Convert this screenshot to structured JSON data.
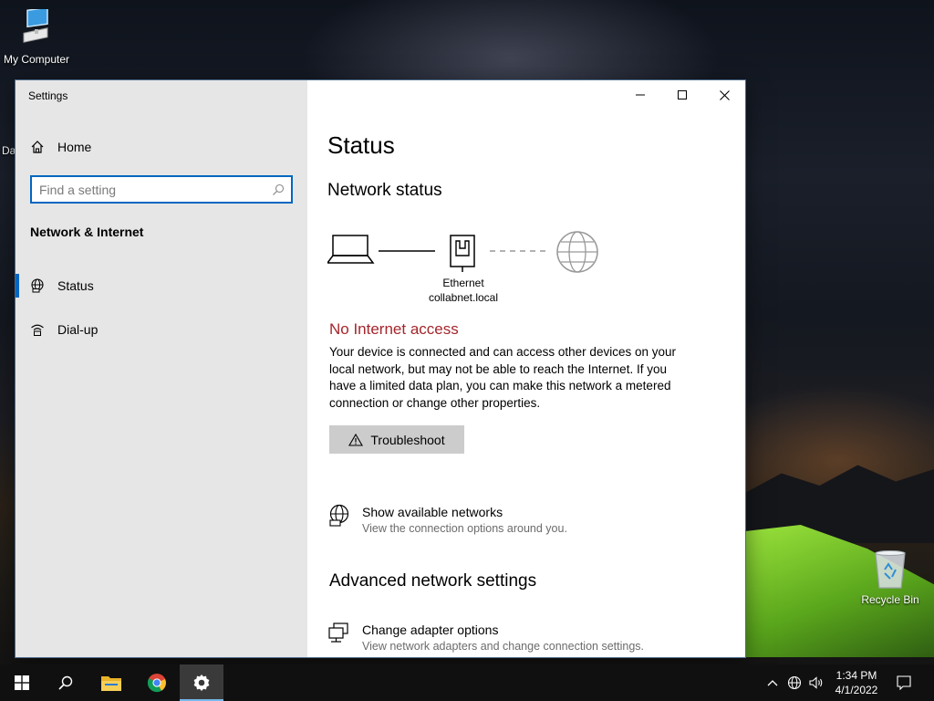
{
  "desktop": {
    "my_computer_label": "My Computer",
    "truncated_label": "Da",
    "recycle_bin_label": "Recycle Bin"
  },
  "window": {
    "title": "Settings",
    "controls": {
      "minimize": "minimize-icon",
      "maximize": "maximize-icon",
      "close": "close-icon"
    }
  },
  "sidebar": {
    "home_label": "Home",
    "search_placeholder": "Find a setting",
    "section_title": "Network & Internet",
    "items": [
      {
        "label": "Status",
        "icon": "globe-icon",
        "active": true
      },
      {
        "label": "Dial-up",
        "icon": "dial-up-icon",
        "active": false
      }
    ]
  },
  "content": {
    "title": "Status",
    "network_status_title": "Network status",
    "diagram": {
      "adapter_name": "Ethernet",
      "network_name": "collabnet.local"
    },
    "alert_text": "No Internet access",
    "description": "Your device is connected and can access other devices on your local network, but may not be able to reach the Internet. If you have a limited data plan, you can make this network a metered connection or change other properties.",
    "troubleshoot_label": "Troubleshoot",
    "show_networks": {
      "title": "Show available networks",
      "subtitle": "View the connection options around you."
    },
    "advanced_title": "Advanced network settings",
    "adapter_options": {
      "title": "Change adapter options",
      "subtitle": "View network adapters and change connection settings."
    }
  },
  "taskbar": {
    "time": "1:34 PM",
    "date": "4/1/2022"
  },
  "colors": {
    "accent": "#0067c0",
    "alert": "#a4262c",
    "sidebar_bg": "#e6e6e6",
    "taskbar_bg": "#101010"
  }
}
